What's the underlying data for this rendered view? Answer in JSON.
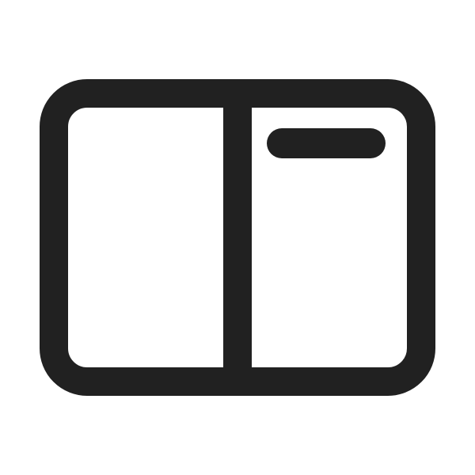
{
  "icon": {
    "name": "split-view-panel-icon",
    "stroke_color": "#212121",
    "background_color": "#ffffff"
  }
}
